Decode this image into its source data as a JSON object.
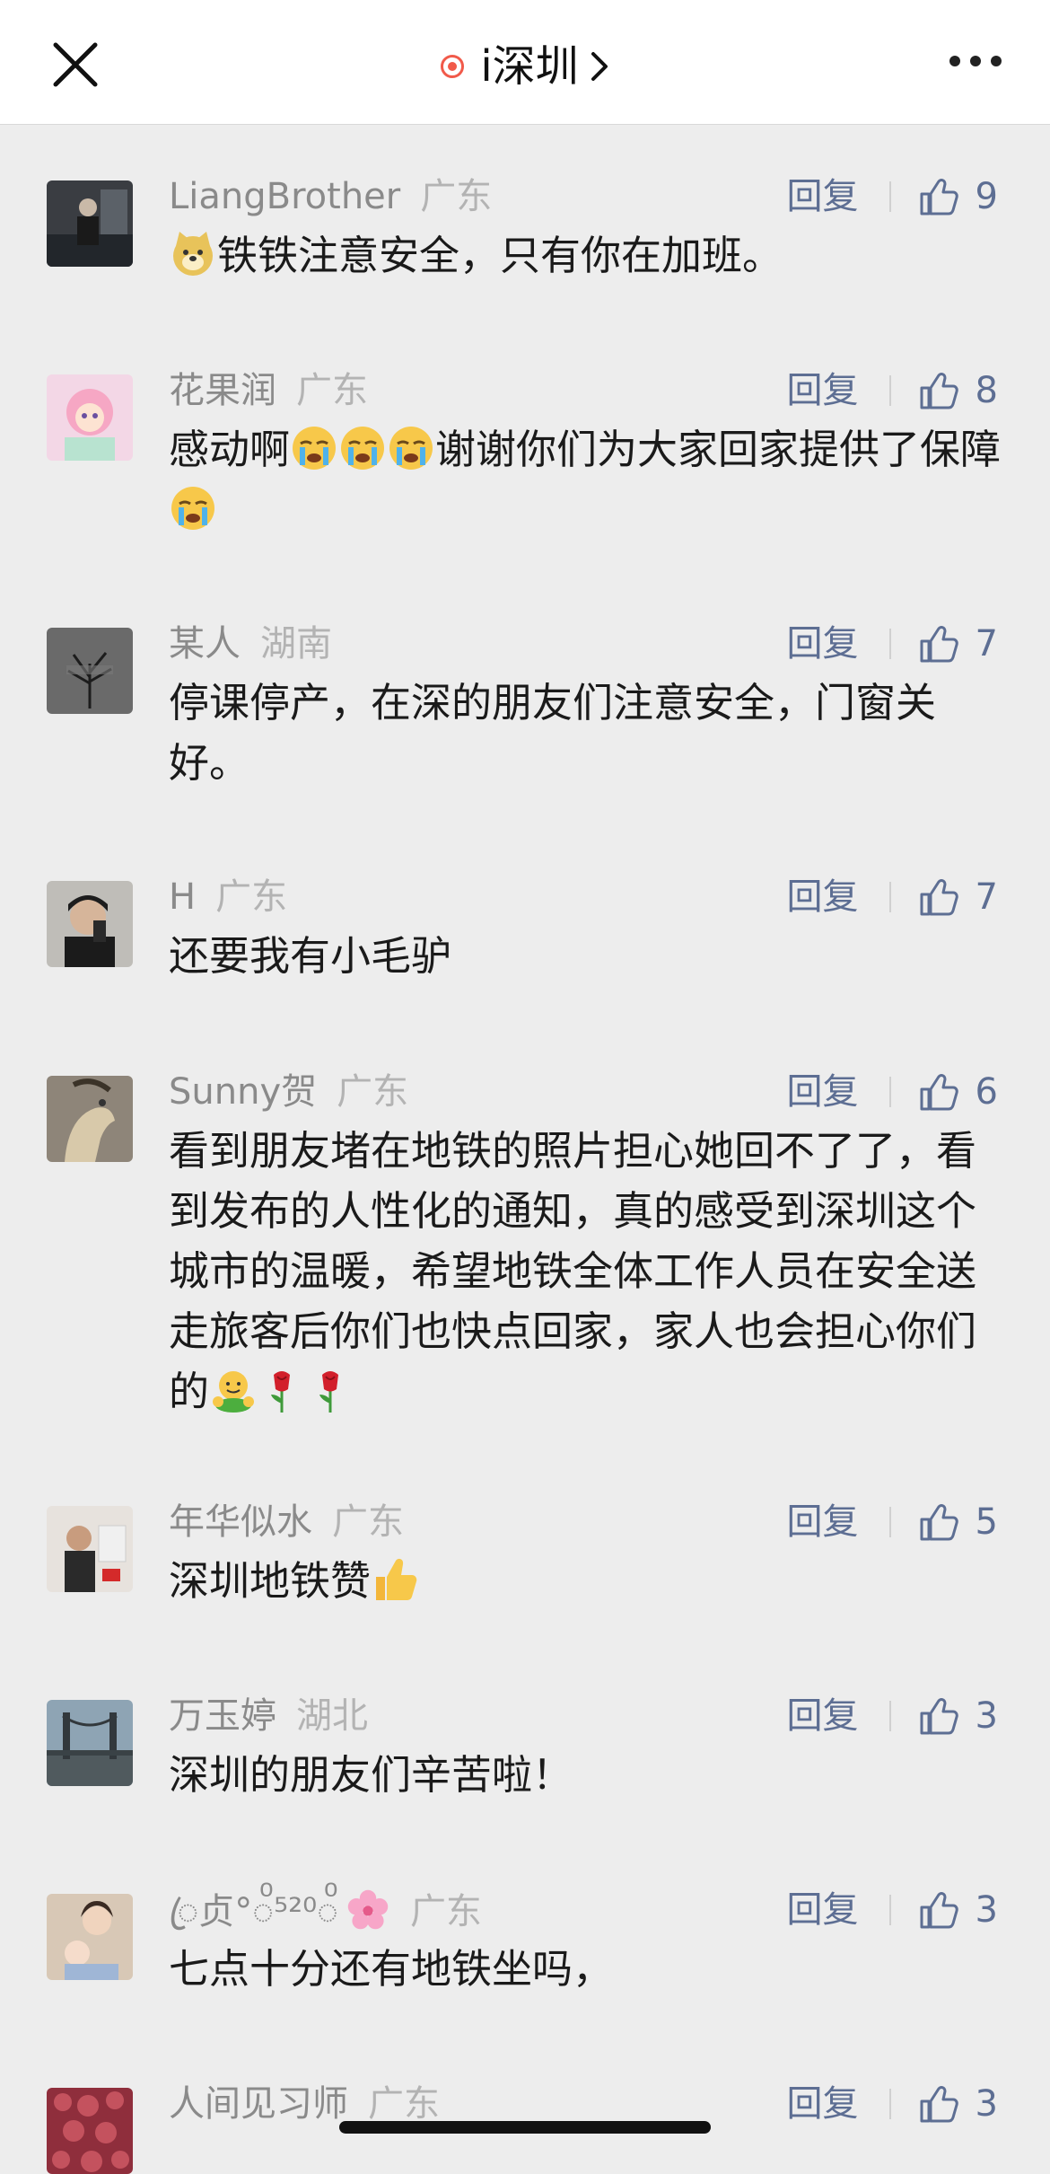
{
  "header": {
    "title": "i深圳",
    "close_icon": "close-icon",
    "more_icon": "more-dots-icon",
    "live_icon": "record-dot-icon",
    "accent": "#f15a4a"
  },
  "comments": [
    {
      "name": "LiangBrother",
      "location": "广东",
      "reply": "回复",
      "likes": "9",
      "text": "铁铁注意安全，只有你在加班。"
    },
    {
      "name": "花果润",
      "location": "广东",
      "reply": "回复",
      "likes": "8",
      "text_a": "感动啊",
      "text_b": "谢谢你们为大家回家提供",
      "text_c": "了保障"
    },
    {
      "name": "某人",
      "location": "湖南",
      "reply": "回复",
      "likes": "7",
      "text": "停课停产，在深的朋友们注意安全，门窗关好。"
    },
    {
      "name": "H",
      "location": "广东",
      "reply": "回复",
      "likes": "7",
      "text": "还要我有小毛驴"
    },
    {
      "name": "Sunny贺",
      "location": "广东",
      "reply": "回复",
      "likes": "6",
      "text": "看到朋友堵在地铁的照片担心她回不了了，看到发布的人性化的通知，真的感受到深圳这个城市的温暖，希望地铁全体工作人员在安全送走旅客后你们也快点回家，家人也会担心你们的"
    },
    {
      "name": "年华似水",
      "location": "广东",
      "reply": "回复",
      "likes": "5",
      "text": "深圳地铁赞"
    },
    {
      "name": "万玉婷",
      "location": "湖北",
      "reply": "回复",
      "likes": "3",
      "text": "深圳的朋友们辛苦啦！"
    },
    {
      "name": "ꦿ贞°◌ͦ⁵²⁰◌ͦ",
      "location": "广东",
      "reply": "回复",
      "likes": "3",
      "text": "七点十分还有地铁坐吗，"
    },
    {
      "name": "人间见习师",
      "location": "广东",
      "reply": "回复",
      "likes": "3",
      "text": ""
    }
  ],
  "colors": {
    "link": "#5d6e93",
    "name": "#8a8a8a",
    "location": "#b3b3b3",
    "background": "#ededed"
  }
}
